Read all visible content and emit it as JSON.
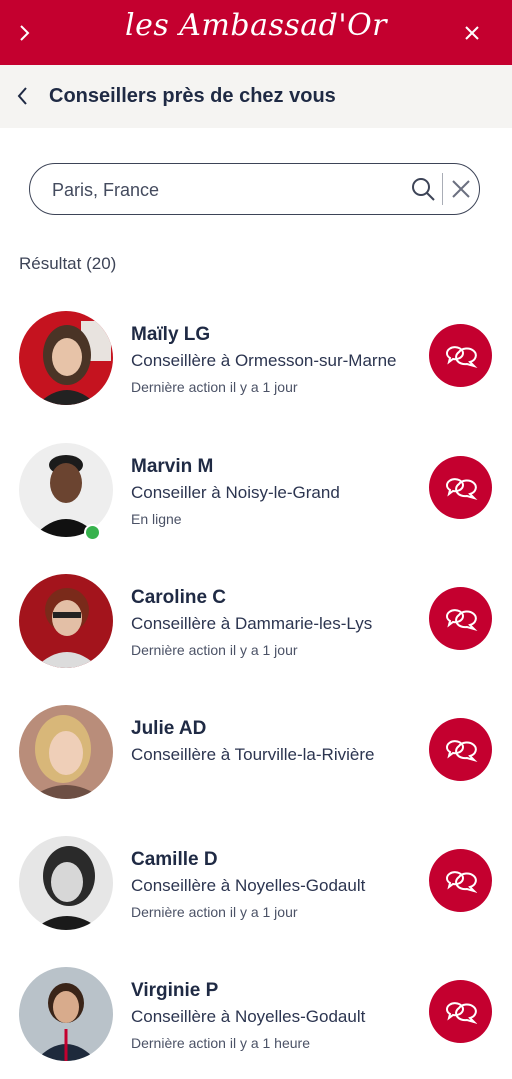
{
  "header": {
    "logo_text": "les Ambassad'Or",
    "left_icon": "chevron-right-icon",
    "right_icon": "close-icon"
  },
  "subheader": {
    "back_icon": "chevron-left-icon",
    "title": "Conseillers près de chez vous"
  },
  "search": {
    "value": "Paris, France",
    "search_icon": "search-icon",
    "clear_icon": "close-icon"
  },
  "results": {
    "label": "Résultat (20)",
    "items": [
      {
        "name": "Maïly LG",
        "location": "Conseillère à Ormesson-sur-Marne",
        "status": "Dernière action il y a 1 jour",
        "online": false
      },
      {
        "name": "Marvin M",
        "location": "Conseiller à Noisy-le-Grand",
        "status": "En ligne",
        "online": true
      },
      {
        "name": "Caroline C",
        "location": "Conseillère à Dammarie-les-Lys",
        "status": "Dernière action il y a 1 jour",
        "online": false
      },
      {
        "name": "Julie AD",
        "location": "Conseillère à Tourville-la-Rivière",
        "status": "",
        "online": false
      },
      {
        "name": "Camille D",
        "location": "Conseillère à Noyelles-Godault",
        "status": "Dernière action il y a 1 jour",
        "online": false
      },
      {
        "name": "Virginie P",
        "location": "Conseillère à Noyelles-Godault",
        "status": "Dernière action il y a 1 heure",
        "online": false
      }
    ]
  },
  "colors": {
    "brand": "#c4002f",
    "text": "#1f2a44",
    "online": "#37b24d"
  }
}
